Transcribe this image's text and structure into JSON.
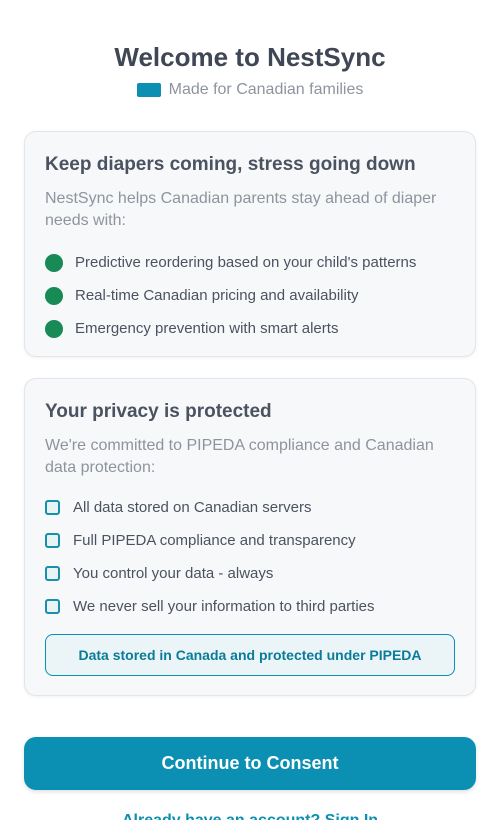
{
  "header": {
    "title": "Welcome to NestSync",
    "subtitle": "Made for Canadian families",
    "flag_icon": "canada-flag-icon"
  },
  "benefits": {
    "title": "Keep diapers coming, stress going down",
    "description": "NestSync helps Canadian parents stay ahead of diaper needs with:",
    "items": [
      "Predictive reordering based on your child's patterns",
      "Real-time Canadian pricing and availability",
      "Emergency prevention with smart alerts"
    ],
    "bullet_color": "#178a55"
  },
  "privacy": {
    "title": "Your privacy is protected",
    "description": "We're committed to PIPEDA compliance and Canadian data protection:",
    "items": [
      "All data stored on Canadian servers",
      "Full PIPEDA compliance and transparency",
      "You control your data - always",
      "We never sell your information to third parties"
    ],
    "notice": "Data stored in Canada and protected under PIPEDA"
  },
  "actions": {
    "continue_label": "Continue to Consent",
    "signin_label": "Already have an account? Sign In"
  },
  "colors": {
    "accent": "#0b8fb3",
    "success": "#178a55"
  }
}
